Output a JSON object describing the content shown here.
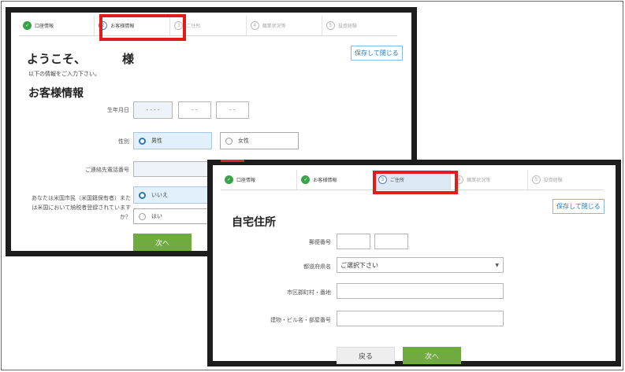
{
  "steps": [
    {
      "number": "",
      "label": "口座情報"
    },
    {
      "number": "2",
      "label": "お客様情報"
    },
    {
      "number": "3",
      "label": "ご住所"
    },
    {
      "number": "4",
      "label": "職業状況等"
    },
    {
      "number": "5",
      "label": "投資経験"
    }
  ],
  "save_close_label": "保存して閉じる",
  "window1": {
    "welcome": "ようこそ、",
    "sama": "様",
    "instruction": "以下の情報をご入力下さい。",
    "section_title": "お客様情報",
    "birthdate_label": "生年月日",
    "birth_year": "- - - -",
    "birth_month": "- -",
    "birth_day": "- -",
    "gender_label": "性別",
    "gender_male": "男性",
    "gender_female": "女性",
    "phone_label": "ご連絡先電話番号",
    "us_question": "あなたは米国市民（米国籍保有者）または米国において納税者登録されていますか？",
    "no_label": "いいえ",
    "yes_label": "はい",
    "next_label": "次へ"
  },
  "window2": {
    "section_title": "自宅住所",
    "postal_label": "郵便番号",
    "prefecture_label": "都道府県名",
    "prefecture_placeholder": "ご選択下さい",
    "city_label": "市区郡町村・番地",
    "building_label": "建物・ビル名・部屋番号",
    "back_label": "戻る",
    "next_label": "次へ"
  },
  "colors": {
    "accent_green": "#6fab3f",
    "highlight_red": "#e31b1b",
    "link_blue": "#2a78b6"
  }
}
